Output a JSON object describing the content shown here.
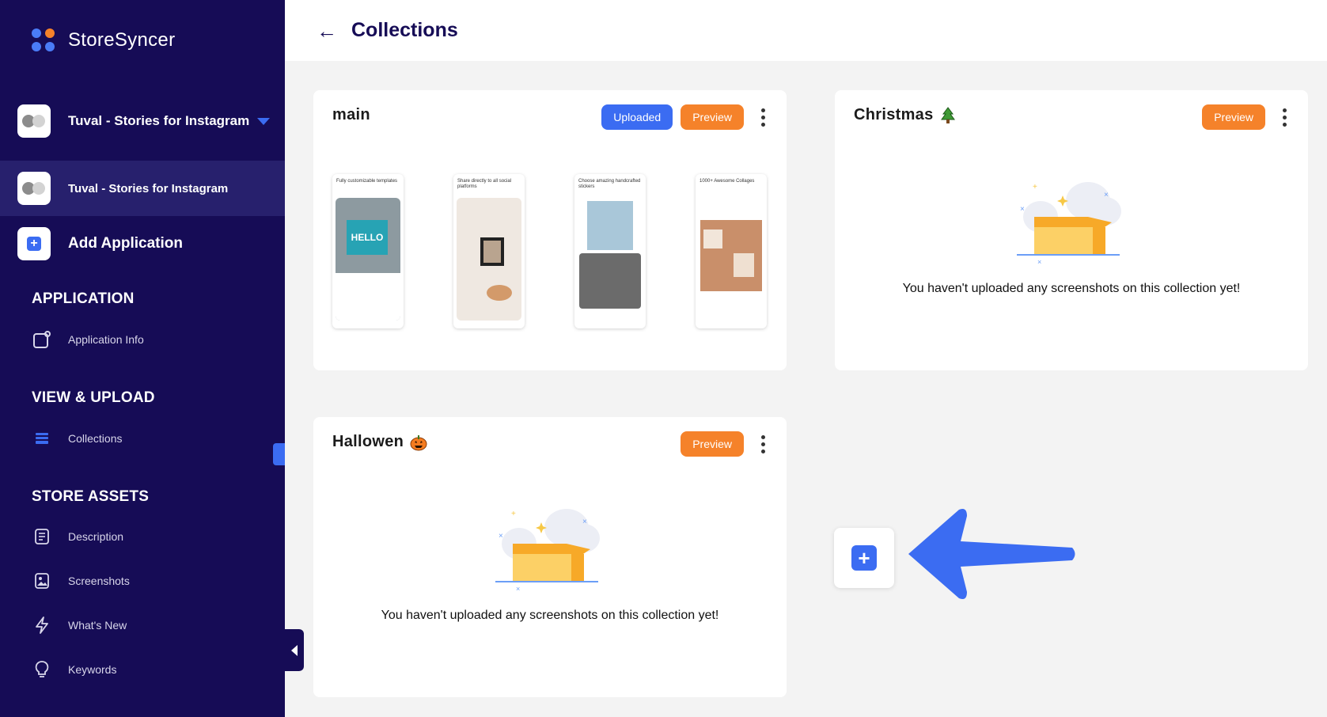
{
  "brand": {
    "name": "StoreSyncer"
  },
  "app_switcher": {
    "current": "Tuval - Stories for Instagram"
  },
  "apps": [
    {
      "name": "Tuval - Stories for Instagram"
    }
  ],
  "add_application": {
    "label": "Add Application"
  },
  "sections": {
    "application": {
      "title": "APPLICATION",
      "items": [
        {
          "label": "Application Info",
          "icon": "app-info-icon"
        }
      ]
    },
    "view_upload": {
      "title": "VIEW & UPLOAD",
      "items": [
        {
          "label": "Collections",
          "icon": "collections-icon"
        }
      ]
    },
    "store_assets": {
      "title": "STORE ASSETS",
      "items": [
        {
          "label": "Description",
          "icon": "document-icon"
        },
        {
          "label": "Screenshots",
          "icon": "image-icon"
        },
        {
          "label": "What's New",
          "icon": "lightning-icon"
        },
        {
          "label": "Keywords",
          "icon": "lightbulb-icon"
        }
      ]
    }
  },
  "header": {
    "title": "Collections"
  },
  "collections": [
    {
      "name": "main",
      "uploaded_label": "Uploaded",
      "preview_label": "Preview",
      "screenshots": [
        {
          "caption": "Fully customizable templates",
          "text": "HELLO"
        },
        {
          "caption": "Share directly to all social platforms"
        },
        {
          "caption": "Choose amazing handcrafted stickers"
        },
        {
          "caption": "1000+ Awesome Collages"
        }
      ]
    },
    {
      "name": "Christmas",
      "emoji": "tree-icon",
      "preview_label": "Preview",
      "empty_message": "You haven't uploaded any screenshots on this collection yet!"
    },
    {
      "name": "Hallowen",
      "emoji": "pumpkin-icon",
      "preview_label": "Preview",
      "empty_message": "You haven't uploaded any screenshots on this collection yet!"
    }
  ],
  "colors": {
    "sidebar": "#160c56",
    "accent": "#3b6cf2",
    "preview": "#f5822a",
    "background": "#f3f3f3"
  }
}
